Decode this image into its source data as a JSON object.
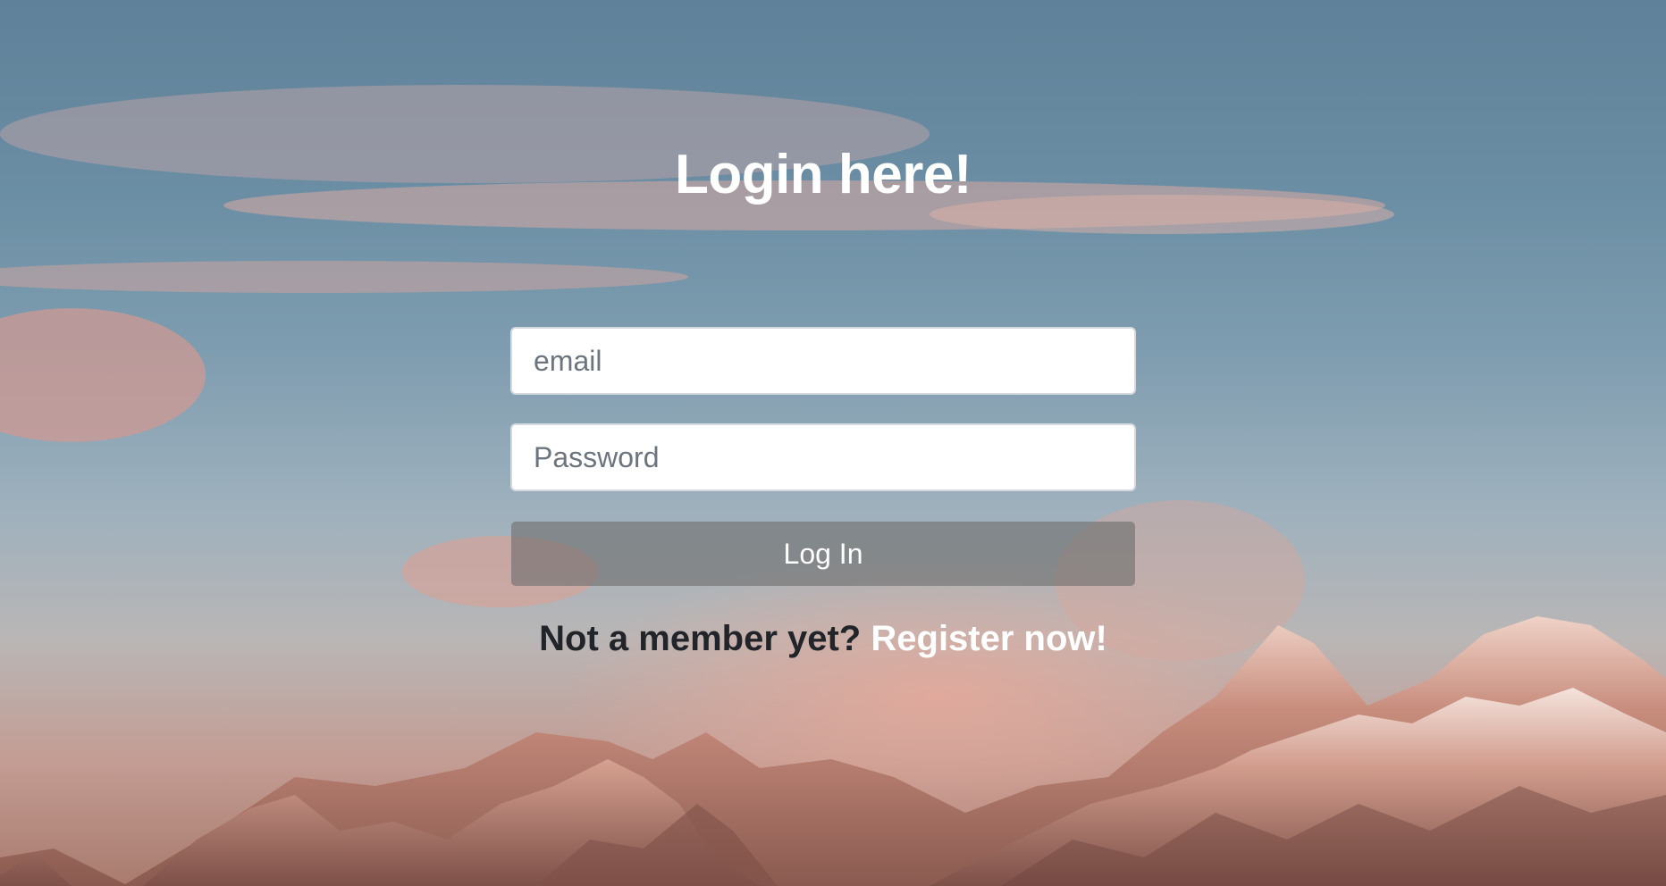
{
  "page": {
    "title": "Login here!"
  },
  "form": {
    "email_placeholder": "email",
    "email_value": "",
    "password_placeholder": "Password",
    "password_value": "",
    "submit_label": "Log In"
  },
  "register": {
    "prompt": "Not a member yet?",
    "link_label": "Register now!"
  },
  "colors": {
    "title": "#ffffff",
    "button_bg": "#6e6e6e",
    "link": "#ffffff",
    "prompt_text": "#212529"
  },
  "background": {
    "icon": "mountain-sky-background"
  }
}
